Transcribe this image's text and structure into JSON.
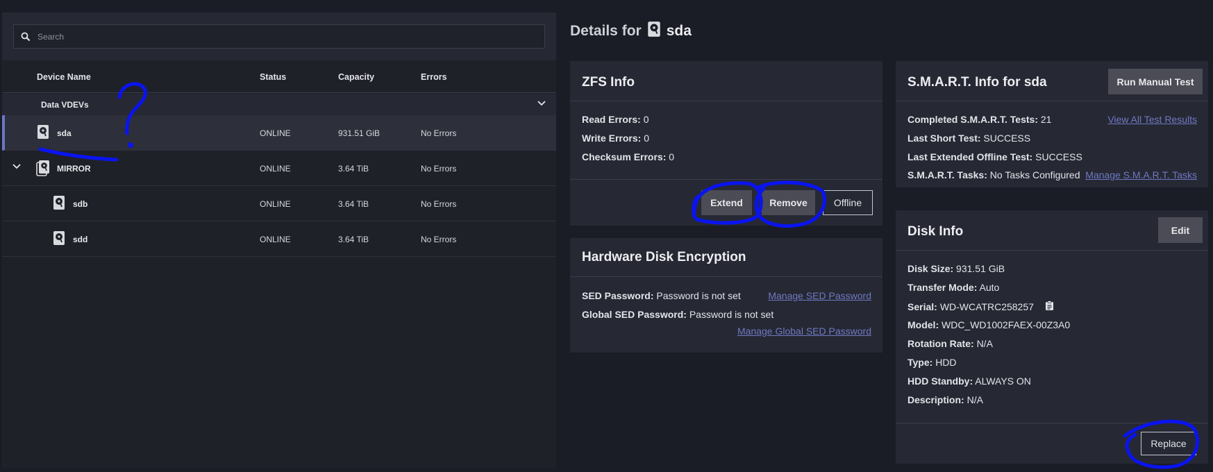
{
  "search": {
    "placeholder": "Search"
  },
  "table": {
    "columns": [
      "Device Name",
      "Status",
      "Capacity",
      "Errors"
    ],
    "group_label": "Data VDEVs",
    "rows": [
      {
        "name": "sda",
        "status": "ONLINE",
        "capacity": "931.51 GiB",
        "errors": "No Errors",
        "selected": true,
        "icon": "hard-disk-icon"
      },
      {
        "name": "MIRROR",
        "status": "ONLINE",
        "capacity": "3.64 TiB",
        "errors": "No Errors",
        "icon": "mirror-disks-icon"
      },
      {
        "name": "sdb",
        "status": "ONLINE",
        "capacity": "3.64 TiB",
        "errors": "No Errors",
        "icon": "hard-disk-icon"
      },
      {
        "name": "sdd",
        "status": "ONLINE",
        "capacity": "3.64 TiB",
        "errors": "No Errors",
        "icon": "hard-disk-icon"
      }
    ]
  },
  "details": {
    "prefix": "Details for",
    "device": "sda"
  },
  "zfs": {
    "title": "ZFS Info",
    "read_label": "Read Errors:",
    "read_value": "0",
    "write_label": "Write Errors:",
    "write_value": "0",
    "checksum_label": "Checksum Errors:",
    "checksum_value": "0",
    "extend": "Extend",
    "remove": "Remove",
    "offline": "Offline"
  },
  "hde": {
    "title": "Hardware Disk Encryption",
    "sed_label": "SED Password:",
    "sed_value": "Password is not set",
    "global_label": "Global SED Password:",
    "global_value": "Password is not set",
    "manage_sed": "Manage SED Password",
    "manage_global": "Manage Global SED Password"
  },
  "smart": {
    "title": "S.M.A.R.T. Info for sda",
    "run_button": "Run Manual Test",
    "completed_label": "Completed S.M.A.R.T. Tests:",
    "completed_value": "21",
    "view_all": "View All Test Results",
    "short_label": "Last Short Test:",
    "short_value": "SUCCESS",
    "extended_label": "Last Extended Offline Test:",
    "extended_value": "SUCCESS",
    "tasks_label": "S.M.A.R.T. Tasks:",
    "tasks_value": "No Tasks Configured",
    "manage_tasks": "Manage S.M.A.R.T. Tasks"
  },
  "disk": {
    "title": "Disk Info",
    "edit": "Edit",
    "size_label": "Disk Size:",
    "size_value": "931.51 GiB",
    "transfer_label": "Transfer Mode:",
    "transfer_value": "Auto",
    "serial_label": "Serial:",
    "serial_value": "WD-WCATRC258257",
    "model_label": "Model:",
    "model_value": "WDC_WD1002FAEX-00Z3A0",
    "rotation_label": "Rotation Rate:",
    "rotation_value": "N/A",
    "type_label": "Type:",
    "type_value": "HDD",
    "standby_label": "HDD Standby:",
    "standby_value": "ALWAYS ON",
    "desc_label": "Description:",
    "desc_value": "N/A",
    "replace": "Replace"
  },
  "colors": {
    "accent": "#6b78c6",
    "background": "#1a1c26",
    "card": "#262834",
    "annotation": "#0a14f0"
  }
}
